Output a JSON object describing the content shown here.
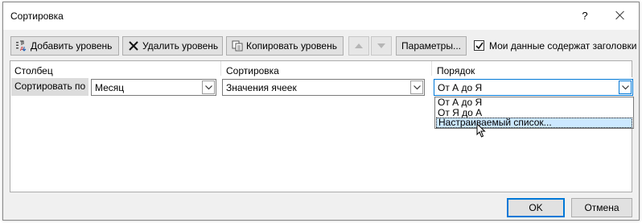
{
  "window": {
    "title": "Сортировка",
    "help_label": "?"
  },
  "toolbar": {
    "add_level_label": "Добавить уровень",
    "delete_level_label": "Удалить уровень",
    "copy_level_label": "Копировать уровень",
    "options_label": "Параметры...",
    "headers_checkbox_label": "Мои данные содержат заголовки",
    "headers_checked": true
  },
  "grid": {
    "columns": [
      "Столбец",
      "Сортировка",
      "Порядок"
    ],
    "row": {
      "label": "Сортировать по",
      "column_value": "Месяц",
      "sort_on_value": "Значения ячеек",
      "order_value": "От А до Я"
    },
    "order_options": [
      "От А до Я",
      "От Я до А",
      "Настраиваемый список..."
    ],
    "selected_option_index": 2
  },
  "footer": {
    "ok_label": "OK",
    "cancel_label": "Отмена"
  },
  "colors": {
    "accent": "#0078d7",
    "selection_bg": "#cce8ff",
    "dialog_bg": "#f0f0f0"
  }
}
